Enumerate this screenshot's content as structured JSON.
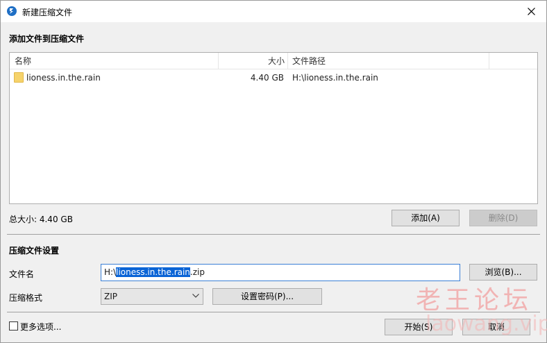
{
  "window": {
    "title": "新建压缩文件",
    "icons": {
      "app": "app-logo-icon",
      "close": "close-icon"
    }
  },
  "add_section": {
    "title": "添加文件到压缩文件"
  },
  "file_list": {
    "columns": [
      "名称",
      "大小",
      "文件路径"
    ],
    "rows": [
      {
        "name": "lioness.in.the.rain",
        "size": "4.40 GB",
        "path": "H:\\lioness.in.the.rain",
        "icon": "folder-icon"
      }
    ]
  },
  "total_size": "总大小: 4.40 GB",
  "buttons": {
    "add": "添加(A)",
    "delete": "删除(D)",
    "browse": "浏览(B)...",
    "set_password": "设置密码(P)...",
    "start": "开始(S)",
    "cancel": "取消"
  },
  "settings": {
    "title": "压缩文件设置",
    "filename_label": "文件名",
    "filename_prefix": "H:\\",
    "filename_selected": "lioness.in.the.rain",
    "filename_suffix": ".zip",
    "format_label": "压缩格式",
    "format_value": "ZIP"
  },
  "more_options": {
    "label": "更多选项...",
    "checked": false
  },
  "watermark": {
    "cn": "老王论坛",
    "en": "laowang.vip"
  },
  "colors": {
    "accent": "#1f6fc5",
    "selection": "#0a64d6",
    "input_border": "#3a7fd5"
  }
}
